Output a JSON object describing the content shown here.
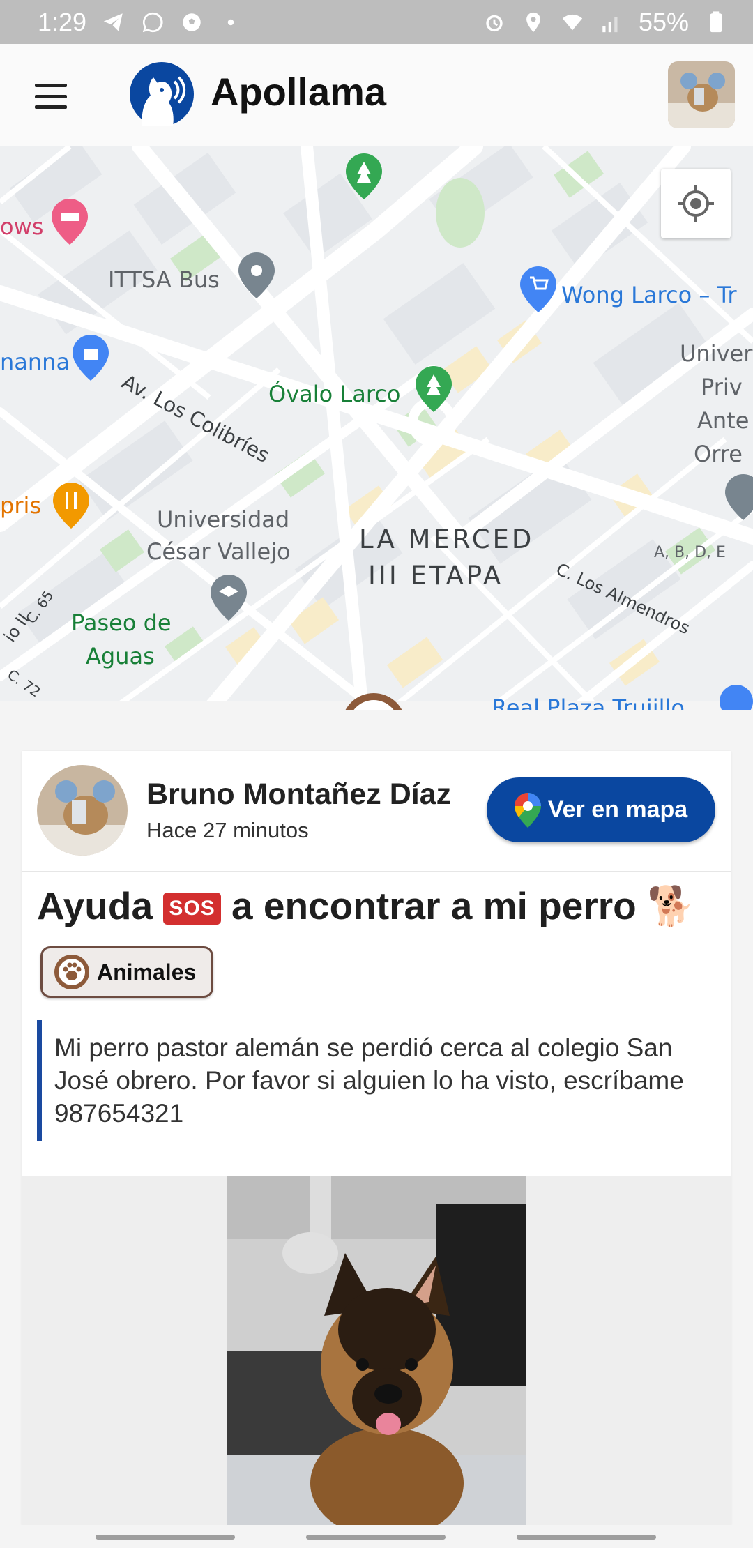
{
  "status_bar": {
    "time": "1:29",
    "battery": "55%",
    "left_icons": [
      "telegram-icon",
      "whatsapp-icon",
      "soccer-ball-icon",
      "dot-icon"
    ],
    "right_icons": [
      "alarm-icon",
      "location-icon",
      "wifi-icon",
      "signal-icon",
      "battery-icon"
    ]
  },
  "app_bar": {
    "title": "Apollama",
    "brand_color": "#0a47a0"
  },
  "map": {
    "labels": {
      "ows": "ows",
      "ittsa": "ITTSA Bus",
      "wong": "Wong Larco – Tr",
      "anna": "nanna",
      "colibries": "Av. Los Colibríes",
      "ovalo": "Óvalo Larco",
      "univer1": "Univer",
      "univer2": "Priv",
      "univer3": "Ante",
      "univer4": "Orre",
      "pris": "pris",
      "ucv1": "Universidad",
      "ucv2": "César Vallejo",
      "merced1": "LA MERCED",
      "merced2": "III ETAPA",
      "abde": "A, B, D, E",
      "almendros": "C. Los Almendros",
      "paseo1": "Paseo de",
      "paseo2": "Aguas",
      "c65": "C. 65",
      "c72": "C. 72",
      "io": "io II",
      "real": "Real Plaza Trujillo"
    }
  },
  "post": {
    "author": "Bruno Montañez Díaz",
    "time_ago": "Hace 27 minutos",
    "map_button": "Ver en mapa",
    "title_part1": "Ayuda",
    "sos": "SOS",
    "title_part2": "a encontrar a mi perro",
    "title_emoji": "🐕",
    "category": "Animales",
    "description": "Mi perro pastor alemán se perdió cerca al colegio San José obrero. Por favor si alguien lo ha visto, escríbame 987654321"
  }
}
